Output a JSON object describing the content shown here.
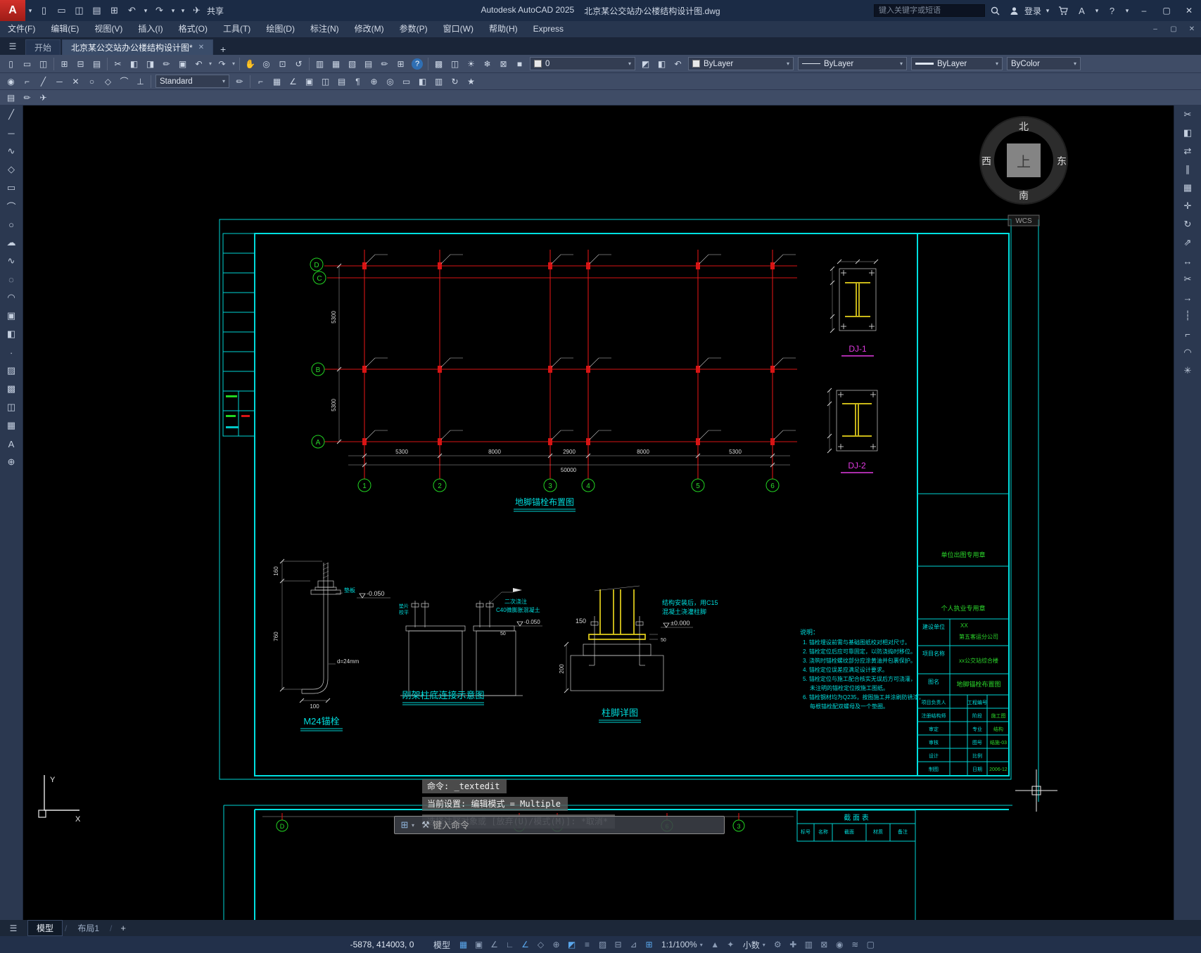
{
  "window": {
    "app_title": "Autodesk AutoCAD 2025",
    "doc_title": "北京某公交站办公楼结构设计图.dwg",
    "search_placeholder": "键入关键字或短语",
    "signin": "登录",
    "share": "共享",
    "logo": "A"
  },
  "menubar": [
    "文件(F)",
    "编辑(E)",
    "视图(V)",
    "插入(I)",
    "格式(O)",
    "工具(T)",
    "绘图(D)",
    "标注(N)",
    "修改(M)",
    "参数(P)",
    "窗口(W)",
    "帮助(H)",
    "Express"
  ],
  "filetabs": {
    "start": "开始",
    "doc": "北京某公交站办公楼结构设计图*",
    "close": "✕",
    "add": "+"
  },
  "toolbar": {
    "layer": "0",
    "color": "ByLayer",
    "linetype": "ByLayer",
    "lineweight": "ByLayer",
    "plotstyle": "ByColor",
    "textstyle": "Standard"
  },
  "glyphs": {
    "menu": "☰",
    "caret": "▾",
    "close": "✕",
    "min": "–",
    "max": "▢",
    "restore": "▣",
    "sheet": "▯",
    "folder": "▭",
    "disk": "◫",
    "printer": "⊞",
    "preview": "⊟",
    "publish": "▤",
    "cut": "✂",
    "copy": "◧",
    "paste": "◨",
    "brush": "✏",
    "block": "▣",
    "undo": "↶",
    "redo": "↷",
    "hand": "✋",
    "zoom": "◎",
    "zoomwin": "⊡",
    "zoomprev": "↺",
    "panel": "▥",
    "palette": "▦",
    "cards": "▧",
    "star": "★",
    "calc": "⊞",
    "help": "?",
    "layers": "▩",
    "sun": "☀",
    "freeze": "❄",
    "lock": "⊠",
    "chip": "■",
    "matchl": "◩",
    "dot": "◉",
    "cornerL": "⌐",
    "diag": "╱",
    "cross": "✕",
    "dash": "─",
    "circle": "○",
    "diamond": "◇",
    "arc": "⌒",
    "perp": "⊥",
    "A": "A",
    "para": "¶",
    "wave": "∿",
    "cloud": "☁",
    "oval": "◌",
    "arcup": "◠",
    "point": "∙",
    "hatch": "▨",
    "plus": "✚",
    "mirror": "⇄",
    "parallel": "∥",
    "move": "✛",
    "rotate": "↻",
    "resize": "⇗",
    "stretch": "↔",
    "rarrow": "→",
    "brk": "┆",
    "burst": "✳",
    "grid": "▦",
    "snap": "▣",
    "angle": "∠",
    "ortho": "∟",
    "iso": "◇",
    "otrack": "⊕",
    "osnap": "◩",
    "lwt": "≡",
    "transp": "▨",
    "cycle": "⊟",
    "ducs": "⊿",
    "dyn": "⊞",
    "tri": "▲",
    "spark": "✦",
    "gear": "⚙",
    "perf": "≋",
    "clean": "▢",
    "wrench": "⚒",
    "plane": "✈",
    "slash": "/",
    "box": "□"
  },
  "commandline": {
    "line1": "命令: _textedit",
    "line2": "当前设置: 编辑模式 = Multiple",
    "line3": "选择注释对象或 [放弃(U)/模式(M)]: *取消*",
    "placeholder": "键入命令"
  },
  "layouttabs": {
    "model": "模型",
    "layout1": "布局1",
    "add": "+",
    "sep": "/"
  },
  "statusbar": {
    "coords": "-5878, 414003, 0",
    "model": "模型",
    "scale": "1:1/100%",
    "units": "小数"
  },
  "compass": {
    "n": "北",
    "s": "南",
    "w": "西",
    "e": "东",
    "center": "上",
    "wcs": "WCS"
  },
  "ucs": {
    "x": "X",
    "y": "Y"
  },
  "drawing": {
    "plan_title": "地脚锚栓布置图",
    "rows": [
      "D",
      "C",
      "B",
      "A"
    ],
    "cols": [
      "1",
      "2",
      "3",
      "4",
      "5",
      "6"
    ],
    "dims_bottom": [
      "5300",
      "8000",
      "2900",
      "8000",
      "5300"
    ],
    "dim_total": "50000",
    "dims_left": [
      "5300",
      "5300"
    ],
    "dj1": "DJ-1",
    "dj2": "DJ-2",
    "bolt": {
      "title": "M24锚栓",
      "dim_h": "760",
      "dim_top": "160",
      "dim_w": "100",
      "dia": "d=24mm",
      "plate": "垫板",
      "level": "-0.050"
    },
    "base": {
      "title": "刚架柱底连接示意图",
      "note1": "二次浇注",
      "note2": "C40微膨胀混凝土",
      "pad1": "垫片",
      "pad2": "校平",
      "level": "-0.050",
      "dim": "50"
    },
    "foot": {
      "title": "柱脚详图",
      "dim1": "150",
      "dim2": "200",
      "dim3": "50",
      "note1": "结构安装后，用C15",
      "note2": "混凝土浇灌柱脚",
      "level": "±0.000"
    },
    "notes_title": "说明：",
    "notes": [
      "1. 锚栓埋设前需与基础图纸校对相对尺寸。",
      "2. 锚栓定位后应可靠固定，以防浇捣时移位。",
      "3. 浇筑时锚栓螺纹部分应涂黄油并包裹保护。",
      "4. 锚栓定位误差应满足设计要求。",
      "5. 锚栓定位与施工配合核实无误后方可浇灌，",
      "   未注明的锚栓定位按施工图纸。",
      "6. 锚栓钢材均为Q235，按图施工并涂刷防锈漆，",
      "   每根锚栓配双螺母及一个垫圈。"
    ]
  },
  "titleblock": {
    "seal1": "单位出图专用章",
    "seal2": "个人执业专用章",
    "client_label": "建设单位",
    "client_value1": "XX",
    "client_value2": "第五客运分公司",
    "project_label": "项目名称",
    "project_value": "xx公交站综合楼",
    "name_label": "图名",
    "name_value": "地脚锚栓布置图",
    "rows": [
      {
        "a": "项目负责人",
        "b": "工程编号",
        "c": ""
      },
      {
        "a": "注册结构师",
        "b": "阶段",
        "c": "施工图"
      },
      {
        "a": "审定",
        "b": "专业",
        "c": "结构"
      },
      {
        "a": "审核",
        "b": "图号",
        "c": "结施-03"
      },
      {
        "a": "设计",
        "b": "比例",
        "c": ""
      },
      {
        "a": "制图",
        "b": "日期",
        "c": "2006-12"
      }
    ]
  },
  "section_table": {
    "title": "截 面 表",
    "headers": [
      "标号",
      "名称",
      "截面",
      "材质",
      "备注"
    ]
  },
  "bottom_axes": [
    "D",
    "4",
    "4",
    "6",
    "3"
  ]
}
